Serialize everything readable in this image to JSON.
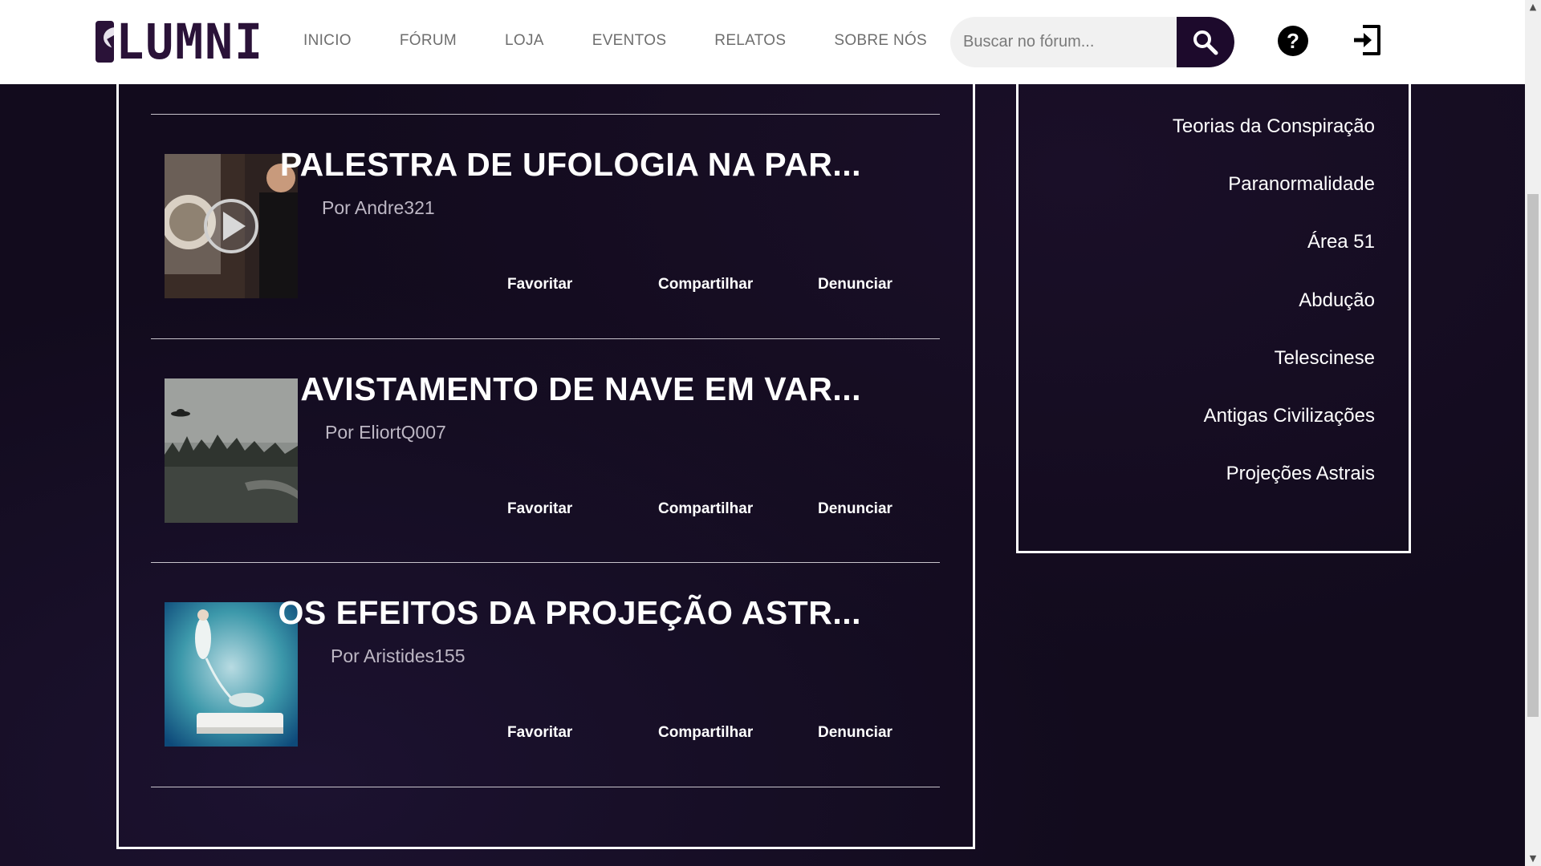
{
  "brand": {
    "name": "LUMNI"
  },
  "nav": [
    {
      "label": "INICIO"
    },
    {
      "label": "FÓRUM"
    },
    {
      "label": "LOJA"
    },
    {
      "label": "EVENTOS"
    },
    {
      "label": "RELATOS"
    },
    {
      "label": "SOBRE NÓS"
    }
  ],
  "search": {
    "placeholder": "Buscar no fórum...",
    "icon": "search-icon"
  },
  "header_icons": {
    "help": "help-icon",
    "login": "login-icon"
  },
  "posts": [
    {
      "title": "PALESTRA DE UFOLOGIA NA PAR...",
      "author": "Por Andre321",
      "thumb": "video-thumbnail",
      "actions": [
        "Favoritar",
        "Compartilhar",
        "Denunciar"
      ]
    },
    {
      "title": "AVISTAMENTO DE NAVE EM VAR...",
      "author": "Por EliortQ007",
      "thumb": "ufo-sighting-photo",
      "actions": [
        "Favoritar",
        "Compartilhar",
        "Denunciar"
      ]
    },
    {
      "title": "OS EFEITOS DA PROJEÇÃO ASTR...",
      "author": "Por Aristides155",
      "thumb": "astral-projection-illustration",
      "actions": [
        "Favoritar",
        "Compartilhar",
        "Denunciar"
      ]
    }
  ],
  "categories": [
    "Teorias da Conspiração",
    "Paranormalidade",
    "Área 51",
    "Abdução",
    "Telescinese",
    "Antigas Civilizações",
    "Projeções Astrais"
  ],
  "colors": {
    "header_bg": "#ffffff",
    "page_bg": "#120b1d",
    "brand": "#2a1238",
    "search_btn": "#1d0a2c"
  }
}
